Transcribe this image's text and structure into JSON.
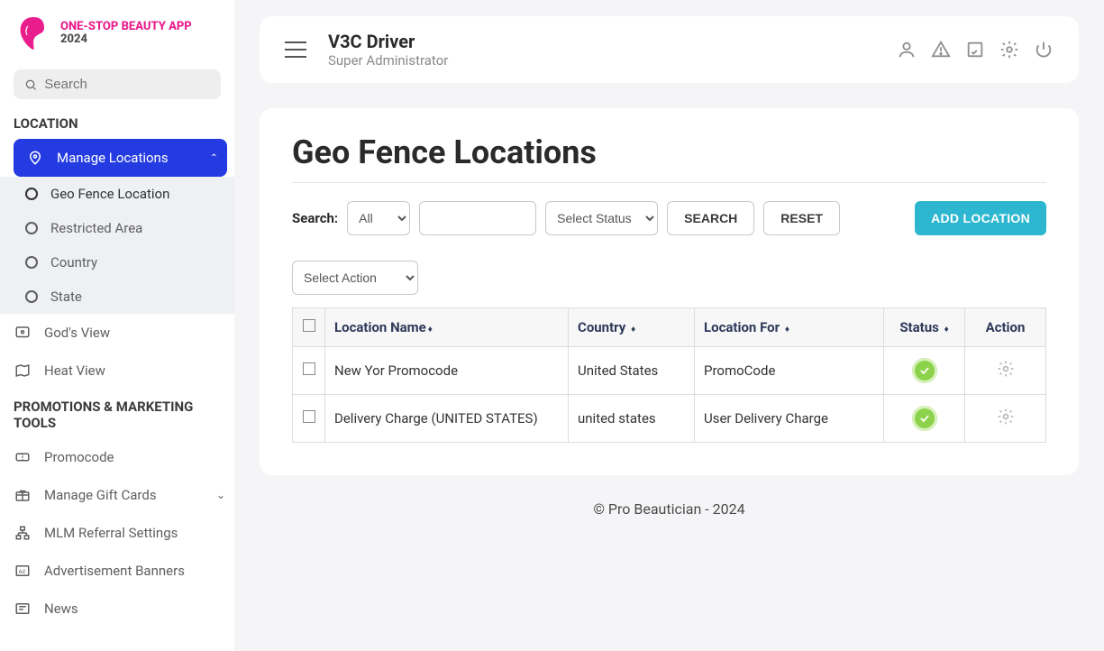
{
  "logo": {
    "line1a": "ONE-STOP ",
    "line1b": "BEAUTY APP",
    "line2": "2024"
  },
  "sidebar": {
    "search_placeholder": "Search",
    "section1": "LOCATION",
    "manage_locations": "Manage Locations",
    "sub": {
      "geo_fence": "Geo Fence Location",
      "restricted": "Restricted Area",
      "country": "Country",
      "state": "State"
    },
    "gods_view": "God's View",
    "heat_view": "Heat View",
    "section2": "PROMOTIONS & MARKETING TOOLS",
    "promocode": "Promocode",
    "gift_cards": "Manage Gift Cards",
    "mlm": "MLM Referral Settings",
    "ad_banners": "Advertisement Banners",
    "news": "News"
  },
  "header": {
    "title": "V3C Driver",
    "subtitle": "Super Administrator"
  },
  "page": {
    "title": "Geo Fence Locations",
    "search_label": "Search:",
    "filter_all": "All",
    "filter_status": "Select Status",
    "btn_search": "SEARCH",
    "btn_reset": "RESET",
    "btn_add": "ADD LOCATION",
    "bulk_action": "Select Action",
    "columns": {
      "location_name": "Location Name",
      "country": "Country",
      "location_for": "Location For",
      "status": "Status",
      "action": "Action"
    },
    "rows": [
      {
        "name": "New Yor Promocode",
        "country": "United States",
        "for": "PromoCode"
      },
      {
        "name": "Delivery Charge (UNITED STATES)",
        "country": "united states",
        "for": "User Delivery Charge"
      }
    ]
  },
  "footer": "© Pro Beautician - 2024"
}
